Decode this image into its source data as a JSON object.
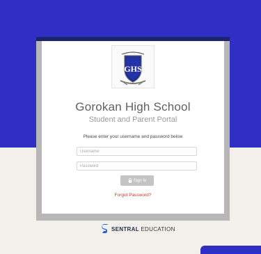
{
  "login": {
    "school_name": "Gorokan High School",
    "portal_subtitle": "Student and Parent Portal",
    "instructions": "Please enter your username and password below",
    "username_placeholder": "Username",
    "password_placeholder": "Password",
    "sign_in_label": "Sign In",
    "forgot_password": "Forgot Password?",
    "crest_text": "GHS"
  },
  "footer": {
    "brand_bold": "SENTRAL",
    "brand_rest": "EDUCATION"
  },
  "icons": {
    "lock": "lock-icon",
    "crest": "school-crest-icon",
    "brand": "sentral-logo-icon"
  },
  "colors": {
    "background_top": "#2f2fc4",
    "background_bottom": "#f3f0eb",
    "frame": "#b7b7b7",
    "frame_top": "#1c2470",
    "button": "#c4c4c4",
    "link": "#c0392b",
    "brand_accent": "#1f5fd1"
  }
}
